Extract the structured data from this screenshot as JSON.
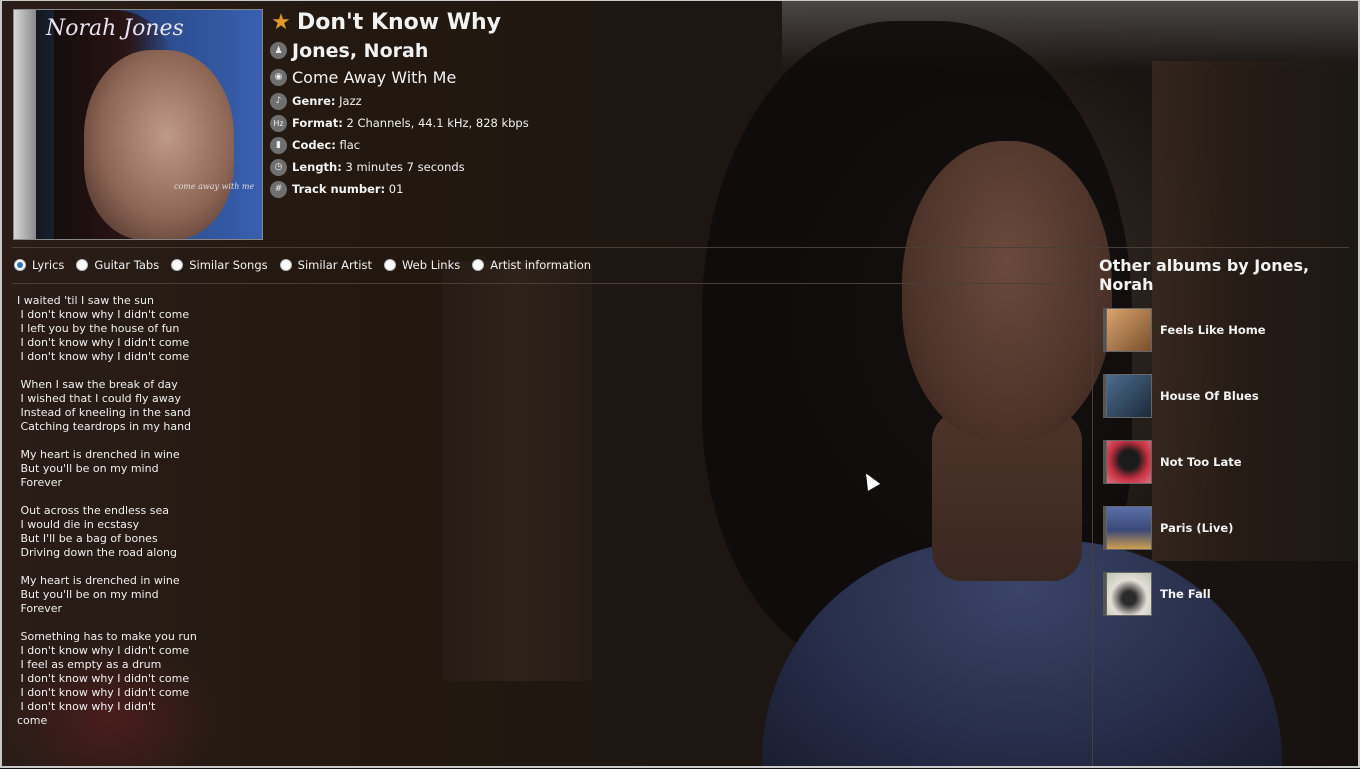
{
  "track": {
    "title": "Don't Know Why",
    "artist": "Jones, Norah",
    "album": "Come Away With Me",
    "cover_artist_text": "Norah Jones",
    "cover_album_text": "come away with me"
  },
  "meta": [
    {
      "icon": "guitar-icon",
      "label": "Genre:",
      "value": "Jazz"
    },
    {
      "icon": "hz-icon",
      "label": "Format:",
      "value": "2 Channels, 44.1 kHz, 828 kbps"
    },
    {
      "icon": "codec-icon",
      "label": "Codec:",
      "value": "flac"
    },
    {
      "icon": "clock-icon",
      "label": "Length:",
      "value": "3 minutes 7 seconds"
    },
    {
      "icon": "hash-icon",
      "label": "Track number:",
      "value": "01"
    }
  ],
  "tabs": [
    {
      "label": "Lyrics",
      "selected": true
    },
    {
      "label": "Guitar Tabs",
      "selected": false
    },
    {
      "label": "Similar Songs",
      "selected": false
    },
    {
      "label": "Similar Artist",
      "selected": false
    },
    {
      "label": "Web Links",
      "selected": false
    },
    {
      "label": "Artist information",
      "selected": false
    }
  ],
  "lyrics": "I waited 'til I saw the sun\n I don't know why I didn't come\n I left you by the house of fun\n I don't know why I didn't come\n I don't know why I didn't come\n\n When I saw the break of day\n I wished that I could fly away\n Instead of kneeling in the sand\n Catching teardrops in my hand\n\n My heart is drenched in wine\n But you'll be on my mind\n Forever\n\n Out across the endless sea\n I would die in ecstasy\n But I'll be a bag of bones\n Driving down the road along\n\n My heart is drenched in wine\n But you'll be on my mind\n Forever\n\n Something has to make you run\n I don't know why I didn't come\n I feel as empty as a drum\n I don't know why I didn't come\n I don't know why I didn't come\n I don't know why I didn't\ncome",
  "sidebar": {
    "title": "Other albums by Jones, Norah",
    "albums": [
      {
        "name": "Feels Like Home",
        "color": "#a8764a"
      },
      {
        "name": "House Of Blues",
        "color": "#2f4e6e"
      },
      {
        "name": "Not Too Late",
        "color": "#b0303a"
      },
      {
        "name": "Paris (Live)",
        "color": "#3e4a78"
      },
      {
        "name": "The Fall",
        "color": "#c9c3bd"
      }
    ]
  },
  "colors": {
    "accent_star": "#e09a22",
    "radio_selected": "#2a6fc9"
  }
}
